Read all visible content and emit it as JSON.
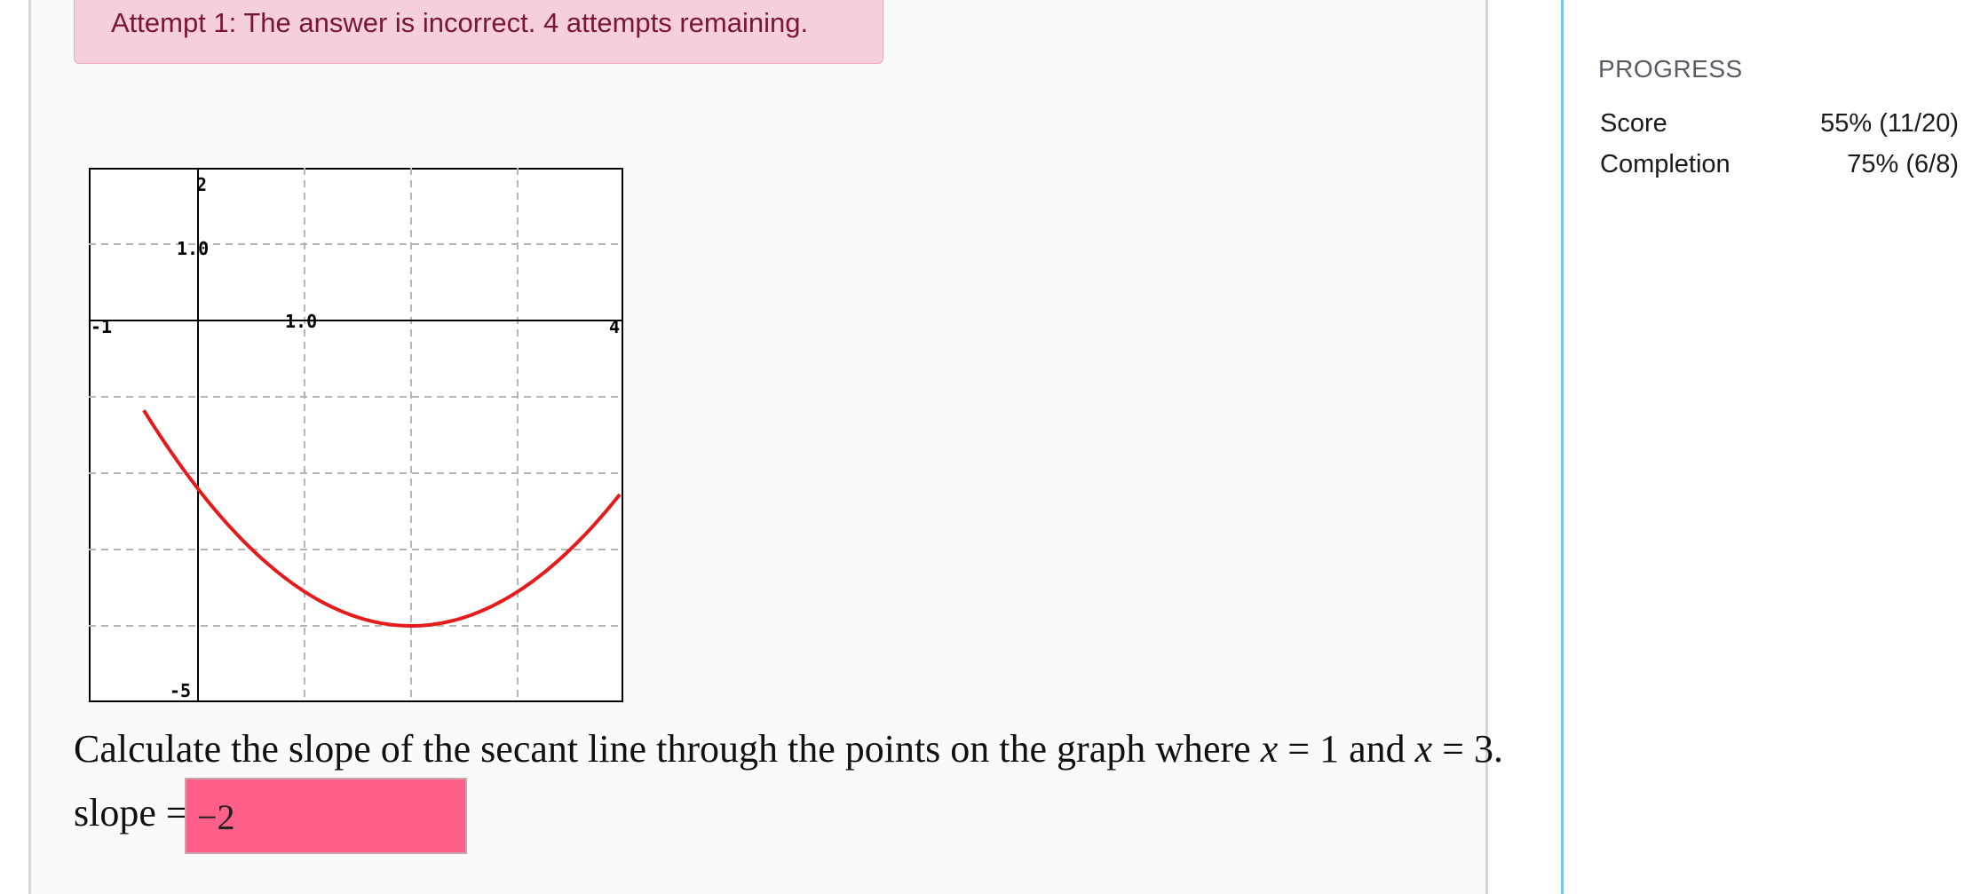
{
  "alert": {
    "message": "Attempt 1: The answer is incorrect. 4 attempts remaining."
  },
  "graph": {
    "function_color": "#e51b1b",
    "labels": {
      "y_max": "2",
      "y_tick": "1.0",
      "x_min": "-1",
      "x_tick": "1.0",
      "x_max": "4",
      "y_min": "-5"
    }
  },
  "question": {
    "text_before": "Calculate the slope of the secant line through the points on the graph where ",
    "var1": "x",
    "eq1": " = 1",
    "mid": " and ",
    "var2": "x",
    "eq2": " = 3."
  },
  "answer": {
    "label": "slope =",
    "value": "−2",
    "status_color": "#ff5f88"
  },
  "sidebar": {
    "heading": "PROGRESS",
    "score_label": "Score",
    "score_value": "55% (11/20)",
    "completion_label": "Completion",
    "completion_value": "75% (6/8)"
  }
}
